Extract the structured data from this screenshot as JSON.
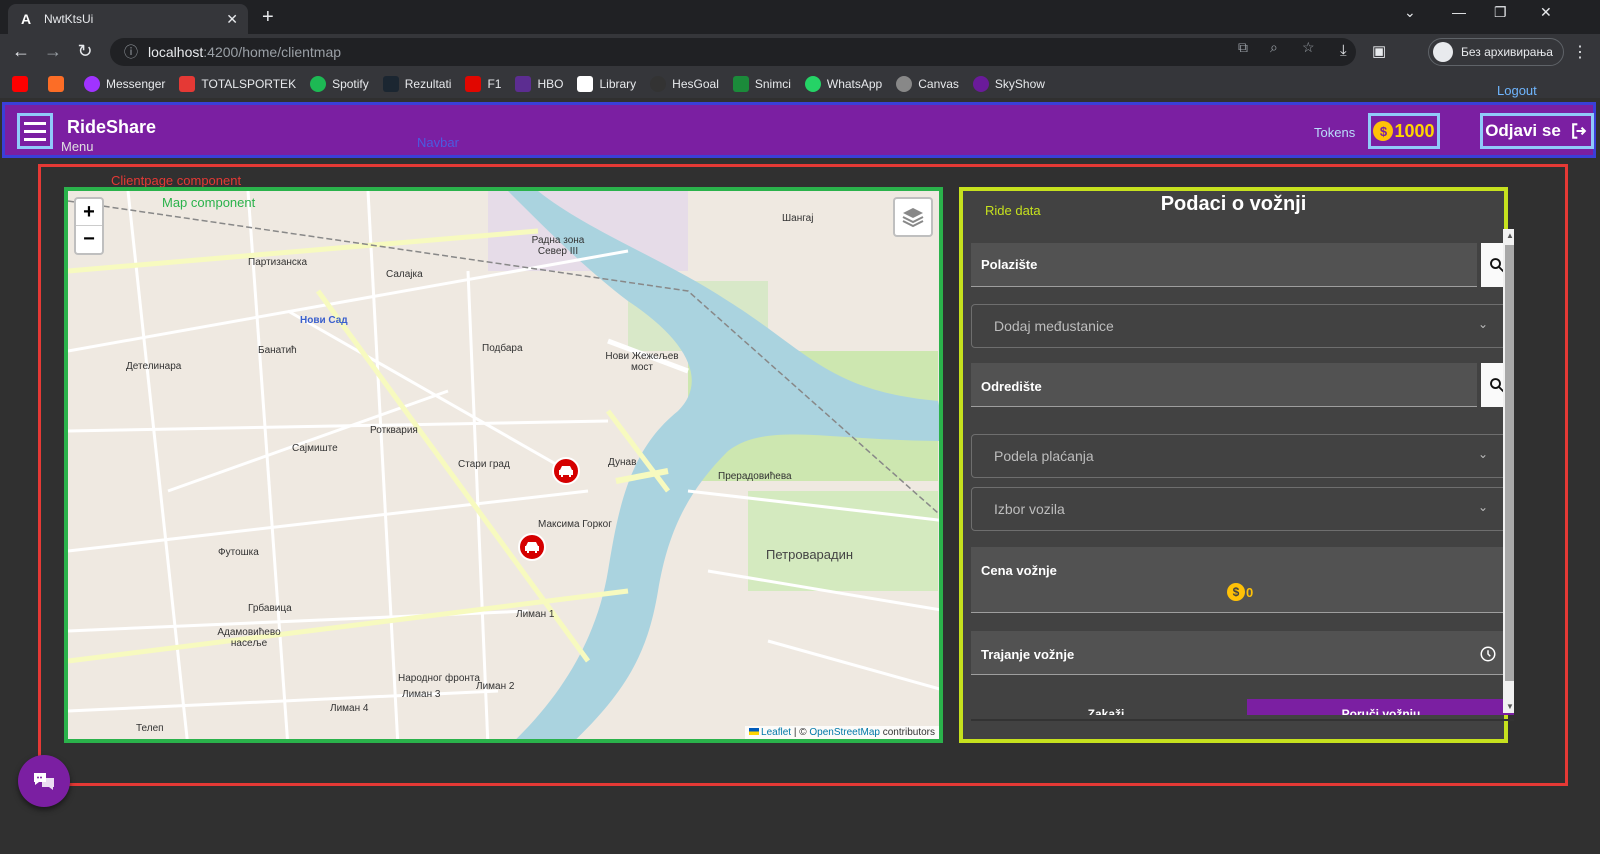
{
  "browser": {
    "tab_title": "NwtKtsUi",
    "url_host": "localhost",
    "url_rest": ":4200/home/clientmap",
    "profile_label": "Без архивирања"
  },
  "bookmarks": [
    {
      "label": "",
      "color": "#ff0000"
    },
    {
      "label": "",
      "color": "#fc6d26"
    },
    {
      "label": "Messenger",
      "color": "#a033ff"
    },
    {
      "label": "TOTALSPORTEK",
      "color": "#e53935"
    },
    {
      "label": "Spotify",
      "color": "#1db954"
    },
    {
      "label": "Rezultati",
      "color": "#1b2631"
    },
    {
      "label": "F1",
      "color": "#e10600"
    },
    {
      "label": "HBO",
      "color": "#5c2d91"
    },
    {
      "label": "Library",
      "color": "#ffffff"
    },
    {
      "label": "HesGoal",
      "color": "#333333"
    },
    {
      "label": "Snimci",
      "color": "#1b8a3a"
    },
    {
      "label": "WhatsApp",
      "color": "#25d366"
    },
    {
      "label": "Canvas",
      "color": "#888888"
    },
    {
      "label": "SkyShow",
      "color": "#6a1b9a"
    }
  ],
  "annotations": {
    "logout": "Logout",
    "navbar": "Navbar",
    "menu": "Menu",
    "tokens": "Tokens",
    "clientpage": "Clientpage component",
    "map": "Map component",
    "ride": "Ride data"
  },
  "navbar": {
    "brand": "RideShare",
    "tokens_value": "1000",
    "logout_label": "Odjavi se"
  },
  "map": {
    "zoom_in": "+",
    "zoom_out": "−",
    "attribution_leaflet": "Leaflet",
    "attribution_sep": " | © ",
    "attribution_osm": "OpenStreetMap",
    "attribution_rest": " contributors",
    "labels": [
      "Партизанска",
      "Салајка",
      "Нови Сад",
      "Банатић",
      "Детелинара",
      "Подбара",
      "Ротквария",
      "Сајмиште",
      "Стари град",
      "Нови Жежељев мост",
      "Радна зона Север III",
      "Петроварадин",
      "Грбавица",
      "Адамовићево насеље",
      "Лиман 1",
      "Лиман 2",
      "Лиман 3",
      "Лиман 4",
      "Телеп",
      "Шангај",
      "Дунав",
      "Футошка",
      "Максима Горког",
      "Прерадовићева",
      "Народног фронта"
    ]
  },
  "ride": {
    "title": "Podaci o vožnji",
    "departure_label": "Polazište",
    "waypoints_placeholder": "Dodaj međustanice",
    "destination_label": "Odredište",
    "payment_split_placeholder": "Podela plaćanja",
    "vehicle_placeholder": "Izbor vozila",
    "price_label": "Cena vožnje",
    "price_value": "0",
    "duration_label": "Trajanje vožnje",
    "cancel_label": "Zakaži",
    "order_label": "Poruči vožnju"
  }
}
